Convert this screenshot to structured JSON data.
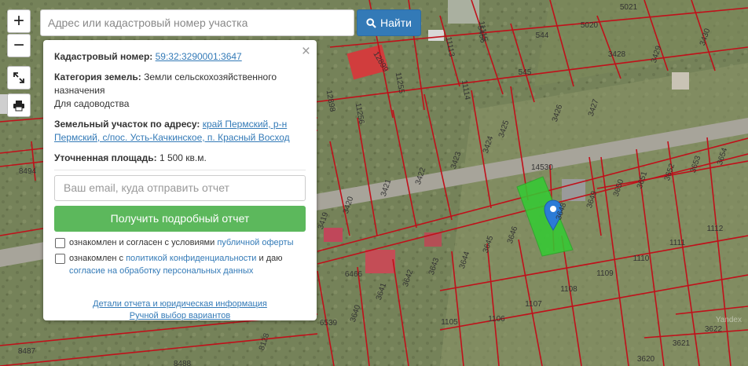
{
  "search": {
    "placeholder": "Адрес или кадастровый номер участка",
    "button_label": "Найти"
  },
  "controls": {
    "zoom_in": "+",
    "zoom_out": "−"
  },
  "panel": {
    "close": "×",
    "cadastral_label": "Кадастровый номер:",
    "cadastral_value": "59:32:3290001:3647",
    "category_label": "Категория земель:",
    "category_value": "Земли сельскохозяйственного назначения",
    "purpose": "Для садоводства",
    "address_label": "Земельный участок по адресу:",
    "address_value": "край Пермский, р-н Пермский, с/пос. Усть-Качкинское, п. Красный Восход",
    "area_label": "Уточненная площадь:",
    "area_value": "1 500 кв.м.",
    "email_placeholder": "Ваш email, куда отправить отчет",
    "get_report_button": "Получить подробный отчет",
    "agree1_text": "ознакомлен и согласен с условиями ",
    "agree1_link": "публичной оферты",
    "agree2_text1": "ознакомлен с ",
    "agree2_link1": "политикой конфиденциальности",
    "agree2_text2": " и даю ",
    "agree2_link2": "согласие на обработку персональных данных",
    "details_link": "Детали отчета и юридическая информация",
    "manual_link": "Ручной выбор вариантов"
  },
  "map": {
    "road_label": "14530",
    "watermark": "Yandex",
    "highlight_color": "#33cc33",
    "marker_color": "#2b7bd6",
    "parcel_labels": [
      {
        "t": "5021"
      },
      {
        "t": "544"
      },
      {
        "t": "5020"
      },
      {
        "t": "545"
      },
      {
        "t": "3428"
      },
      {
        "t": "3429"
      },
      {
        "t": "3430"
      },
      {
        "t": "3427"
      },
      {
        "t": "3426"
      },
      {
        "t": "3425"
      },
      {
        "t": "3424"
      },
      {
        "t": "3423"
      },
      {
        "t": "3422"
      },
      {
        "t": "3421"
      },
      {
        "t": "3420"
      },
      {
        "t": "3419"
      },
      {
        "t": "3645"
      },
      {
        "t": "3646"
      },
      {
        "t": "3648"
      },
      {
        "t": "3649"
      },
      {
        "t": "3650"
      },
      {
        "t": "3651"
      },
      {
        "t": "3652"
      },
      {
        "t": "3653"
      },
      {
        "t": "3654"
      },
      {
        "t": "3644"
      },
      {
        "t": "3643"
      },
      {
        "t": "3642"
      },
      {
        "t": "3641"
      },
      {
        "t": "3640"
      },
      {
        "t": "6466"
      },
      {
        "t": "6539"
      },
      {
        "t": "1112"
      },
      {
        "t": "1111"
      },
      {
        "t": "1110"
      },
      {
        "t": "1109"
      },
      {
        "t": "1108"
      },
      {
        "t": "1107"
      },
      {
        "t": "1106"
      },
      {
        "t": "1105"
      },
      {
        "t": "3622"
      },
      {
        "t": "3621"
      },
      {
        "t": "3620"
      },
      {
        "t": "8487"
      },
      {
        "t": "8488"
      },
      {
        "t": "8494"
      },
      {
        "t": "8128"
      },
      {
        "t": "12899"
      },
      {
        "t": "12898"
      },
      {
        "t": "11256"
      },
      {
        "t": "11257"
      },
      {
        "t": "11255"
      },
      {
        "t": "11113"
      },
      {
        "t": "11114"
      },
      {
        "t": "11115"
      },
      {
        "t": "5456"
      }
    ]
  }
}
